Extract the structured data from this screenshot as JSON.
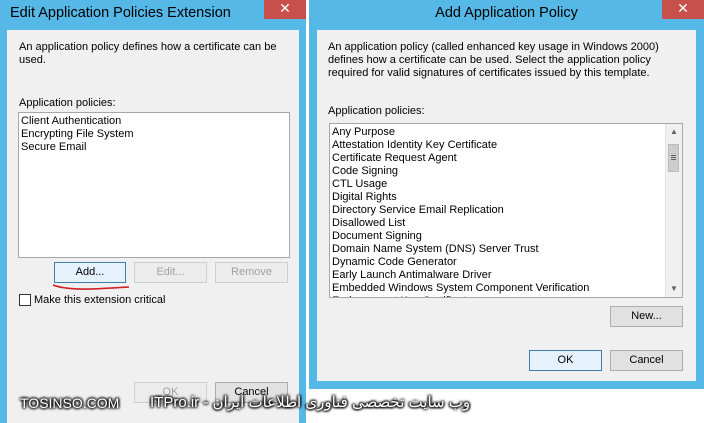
{
  "left_dialog": {
    "title": "Edit Application Policies Extension",
    "close_glyph": "✕",
    "description": "An application policy defines how a certificate can be used.",
    "policies_label": "Application policies:",
    "policies": [
      "Client Authentication",
      "Encrypting File System",
      "Secure Email"
    ],
    "add_label": "Add...",
    "edit_label": "Edit...",
    "remove_label": "Remove",
    "critical_label": "Make this extension critical",
    "ok_label": "OK",
    "cancel_label": "Cancel"
  },
  "right_dialog": {
    "title": "Add Application Policy",
    "close_glyph": "✕",
    "description": "An application policy (called enhanced key usage in Windows 2000) defines how a certificate can be used. Select the application policy required for valid signatures of certificates issued by this template.",
    "policies_label": "Application policies:",
    "policies": [
      "Any Purpose",
      "Attestation Identity Key Certificate",
      "Certificate Request Agent",
      "Code Signing",
      "CTL Usage",
      "Digital Rights",
      "Directory Service Email Replication",
      "Disallowed List",
      "Document Signing",
      "Domain Name System (DNS) Server Trust",
      "Dynamic Code Generator",
      "Early Launch Antimalware Driver",
      "Embedded Windows System Component Verification",
      "Endorsement Key Certificate"
    ],
    "new_label": "New...",
    "ok_label": "OK",
    "cancel_label": "Cancel"
  },
  "watermark": {
    "left": "TOSINSO.COM",
    "right": "وب سایت تخصصی فناوری اطلاعات ایران - ITPro.ir"
  },
  "colors": {
    "title_bar": "#55b8e6",
    "close_button": "#c7504a",
    "annotation": "#d0202a"
  }
}
